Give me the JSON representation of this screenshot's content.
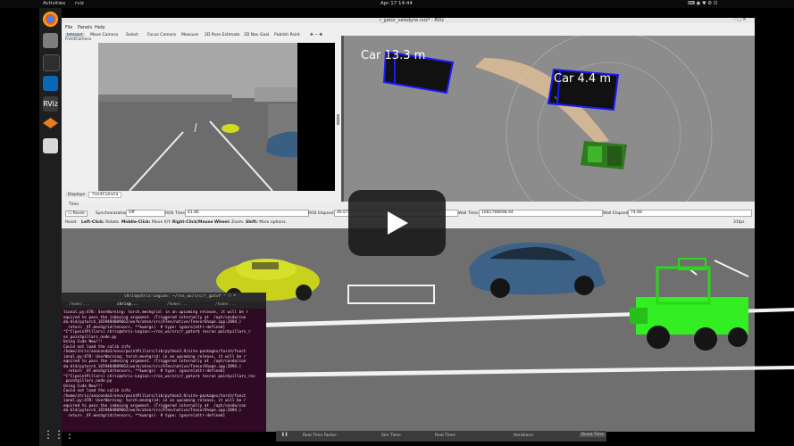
{
  "topbar": {
    "activities": "Activities",
    "app": "rviz",
    "clock": "Apr 17  14:44"
  },
  "rviz": {
    "window_title": "r_gator_velodyne.rviz* - RViz",
    "menu": [
      "File",
      "Panels",
      "Help"
    ],
    "tools": [
      "Interact",
      "Move Camera",
      "Select",
      "Focus Camera",
      "Measure",
      "2D Pose Estimate",
      "2D Nav Goal",
      "Publish Point"
    ],
    "camera_panel_title": "FrontCamera",
    "tabs": [
      "Displays",
      "FrontCamera"
    ],
    "time_panel_title": "Time",
    "pause": "Pause",
    "sync_label": "Synchronization:",
    "sync_value": "Off",
    "ros_time_label": "ROS Time:",
    "ros_time": "41.86",
    "ros_elapsed_label": "ROS Elapsed:",
    "ros_elapsed": "46.67",
    "wall_time_label": "Wall Time:",
    "wall_time": "1681768698.94",
    "wall_elapsed_label": "Wall Elapsed:",
    "wall_elapsed": "74.68",
    "reset": "Reset",
    "hint_l": "Left-Click:",
    "hint_l_text": "Rotate.",
    "hint_m": "Middle-Click:",
    "hint_m_text": "Move X/Y.",
    "hint_r": "Right-Click/Mouse Wheel:",
    "hint_r_text": "Zoom.",
    "hint_s": "Shift:",
    "hint_s_text": "More options.",
    "fps": "31fps",
    "labels": [
      {
        "text": "Car  13.3  m"
      },
      {
        "text": "Car  4.4  m"
      }
    ]
  },
  "terminal": {
    "title": "chris@chris-Legion: ~/ros_ws/src/r_gator",
    "tabs": [
      "/home/...",
      "chris@...",
      "/home/...",
      "/home/..."
    ],
    "lines": [
      "tional.py:478: UserWarning: torch.meshgrid: in an upcoming release, it will be r",
      "equired to pass the indexing argument. (Triggered internally at  /opt/conda/con",
      "da-bld/pytorch_1659484809662/work/aten/src/ATen/native/TensorShape.cpp:2894.)",
      "  return _VF.meshgrid(tensors, **kwargs)  # type: ignore[attr-defined]",
      "^C^C(pointPillars) chris@chris-Legion:~/ros_ws/src/r_gator$ rosrun pointpillars_r",
      "os pointpillars_node.py",
      "Using Cuda Now!!!",
      "Could not load the calib info",
      "/home/chris/anaconda3/envs/pointPillars/lib/python3.9/site-packages/torch/funct",
      "ional.py:478: UserWarning: torch.meshgrid: in an upcoming release, it will be r",
      "equired to pass the indexing argument. (Triggered internally at  /opt/conda/con",
      "da-bld/pytorch_1659484809662/work/aten/src/ATen/native/TensorShape.cpp:2894.)",
      "  return _VF.meshgrid(tensors, **kwargs)  # type: ignore[attr-defined]",
      "^C^C(pointPillars) chris@chris-Legion:~/ros_ws/src/r_gator$ rosrun pointpillars_ros",
      " pointpillars_node.py",
      "Using Cuda Now!!!",
      "Could not load the calib info",
      "/home/chris/anaconda3/envs/pointPillars/lib/python3.9/site-packages/torch/funct",
      "ional.py:478: UserWarning: torch.meshgrid: in an upcoming release, it will be r",
      "equired to pass the indexing argument. (Triggered internally at  /opt/conda/con",
      "da-bld/pytorch_1659484809662/work/aten/src/ATen/native/TensorShape.cpp:2894.)",
      "  return _VF.meshgrid(tensors, **kwargs)  # type: ignore[attr-defined]"
    ]
  },
  "simbar": {
    "real_time_factor_label": "Real Time Factor:",
    "sim_time_label": "Sim Time:",
    "real_time_label": "Real Time:",
    "iterations_label": "Iterations:",
    "reset_time": "Reset Time"
  },
  "colors": {
    "ground": "#6f6f6f",
    "terminal_bg": "#300a24",
    "box_blue": "#1a1aff",
    "tractor_green": "#33ee22"
  }
}
